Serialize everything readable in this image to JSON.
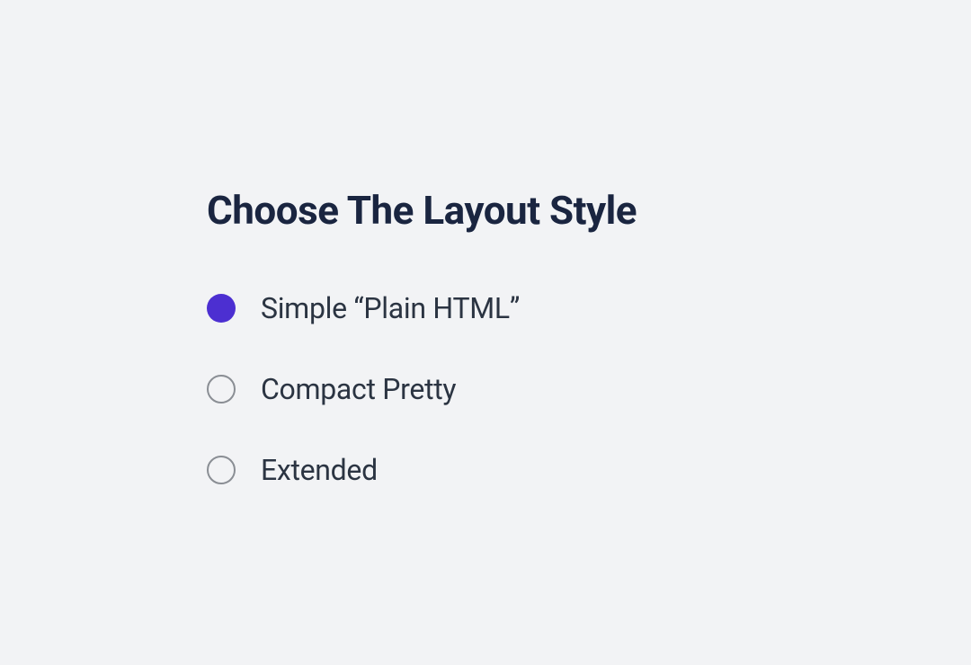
{
  "title": "Choose The Layout Style",
  "options": [
    {
      "label": "Simple “Plain HTML”",
      "selected": true
    },
    {
      "label": "Compact Pretty",
      "selected": false
    },
    {
      "label": "Extended",
      "selected": false
    }
  ]
}
